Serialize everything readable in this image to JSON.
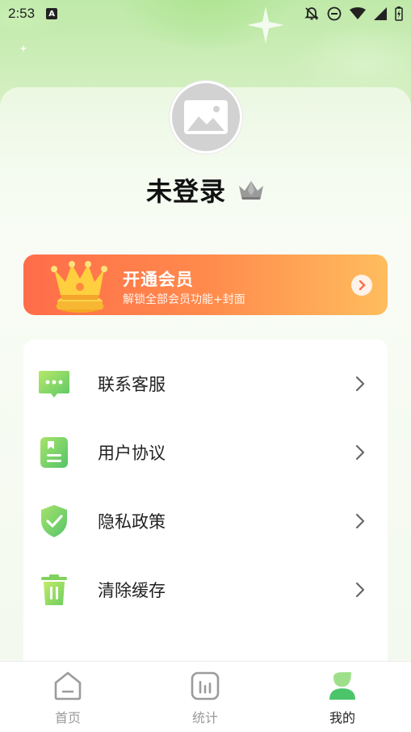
{
  "status_bar": {
    "time": "2:53",
    "notification_badge": "A"
  },
  "profile": {
    "username": "未登录",
    "avatar_icon": "image-placeholder-icon",
    "vip_badge_icon": "crown-icon"
  },
  "vip_banner": {
    "title": "开通会员",
    "subtitle": "解锁全部会员功能+封面",
    "colors": [
      "#ff6d4a",
      "#ffbd5e"
    ]
  },
  "menu": {
    "items": [
      {
        "label": "联系客服",
        "icon": "chat-bubble-icon"
      },
      {
        "label": "用户协议",
        "icon": "document-icon"
      },
      {
        "label": "隐私政策",
        "icon": "shield-check-icon"
      },
      {
        "label": "清除缓存",
        "icon": "trash-icon"
      }
    ]
  },
  "bottom_nav": {
    "items": [
      {
        "label": "首页",
        "icon": "home-icon",
        "active": false
      },
      {
        "label": "统计",
        "icon": "chart-icon",
        "active": false
      },
      {
        "label": "我的",
        "icon": "user-icon",
        "active": true
      }
    ]
  },
  "colors": {
    "accent_green": "#7ed36a",
    "vip_orange": "#ff6d4a"
  }
}
